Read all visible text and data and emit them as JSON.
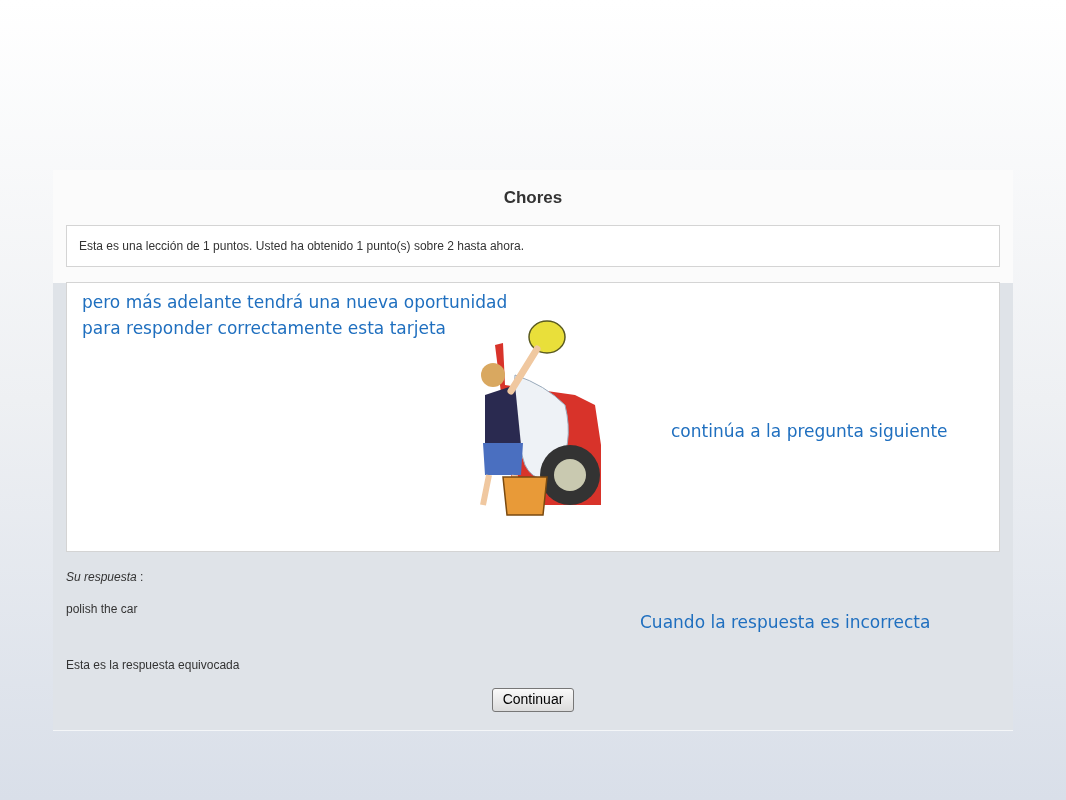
{
  "lesson": {
    "title": "Chores",
    "info": "Esta es una lección de 1 puntos. Usted ha obtenido 1 punto(s) sobre 2 hasta ahora."
  },
  "annotations": {
    "top_lines": [
      "pero más adelante tendrá una nueva oportunidad",
      "para responder correctamente esta tarjeta"
    ],
    "right": "continúa a la pregunta siguiente",
    "bottom": "Cuando la respuesta es incorrecta"
  },
  "answer": {
    "label": "Su respuesta",
    "label_suffix": ":",
    "value": "polish the car",
    "feedback": "Esta es la respuesta equivocada"
  },
  "button": {
    "label": "Continuar"
  }
}
